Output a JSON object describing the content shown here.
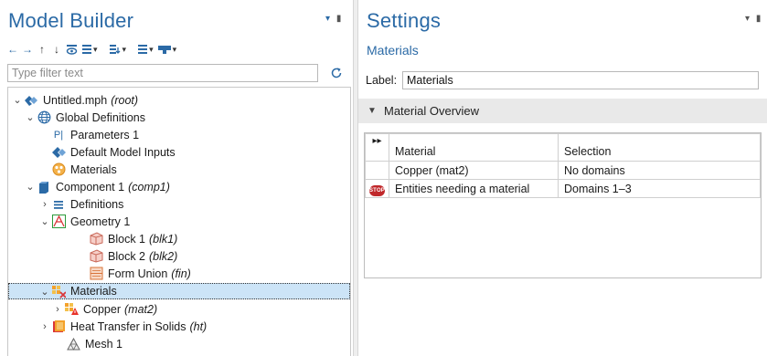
{
  "model_builder": {
    "title": "Model Builder",
    "toolbar": [
      "arrow-left-icon",
      "arrow-right-icon",
      "arrow-up-icon",
      "arrow-down-icon",
      "show-icon",
      "expand-sections-icon",
      "add-node-icon",
      "list-icon",
      "build-icon"
    ],
    "filter_placeholder": "Type filter text",
    "tree": [
      {
        "label": "Untitled.mph",
        "tag": "(root)",
        "icon": "model-file-icon",
        "expanded": true
      },
      {
        "label": "Global Definitions",
        "tag": "",
        "icon": "globe-icon",
        "expanded": true
      },
      {
        "label": "Parameters 1",
        "tag": "",
        "icon": "parameters-icon"
      },
      {
        "label": "Default Model Inputs",
        "tag": "",
        "icon": "model-inputs-icon"
      },
      {
        "label": "Materials",
        "tag": "",
        "icon": "materials-icon"
      },
      {
        "label": "Component 1",
        "tag": "(comp1)",
        "icon": "component-icon",
        "expanded": true
      },
      {
        "label": "Definitions",
        "tag": "",
        "icon": "definitions-icon",
        "expanded": false
      },
      {
        "label": "Geometry 1",
        "tag": "",
        "icon": "geometry-icon",
        "expanded": true
      },
      {
        "label": "Block 1",
        "tag": "(blk1)",
        "icon": "block-icon"
      },
      {
        "label": "Block 2",
        "tag": "(blk2)",
        "icon": "block-icon"
      },
      {
        "label": "Form Union",
        "tag": "(fin)",
        "icon": "form-union-icon"
      },
      {
        "label": "Materials",
        "tag": "",
        "icon": "materials-node-icon",
        "expanded": true,
        "selected": true
      },
      {
        "label": "Copper",
        "tag": "(mat2)",
        "icon": "material-warning-icon",
        "expanded": false
      },
      {
        "label": "Heat Transfer in Solids",
        "tag": "(ht)",
        "icon": "heat-transfer-icon",
        "expanded": false
      },
      {
        "label": "Mesh 1",
        "tag": "",
        "icon": "mesh-icon"
      }
    ]
  },
  "settings": {
    "title": "Settings",
    "subtitle": "Materials",
    "label_caption": "Label:",
    "label_value": "Materials",
    "section_title": "Material Overview",
    "table": {
      "headers": [
        "Material",
        "Selection"
      ],
      "rows": [
        {
          "status": "",
          "material": "Copper (mat2)",
          "selection": "No domains"
        },
        {
          "status": "STOP",
          "material": "Entities needing a material",
          "selection": "Domains 1–3"
        }
      ]
    }
  },
  "colors": {
    "title_blue": "#2b6aa6",
    "selection_bg": "#cce4f7",
    "stop_red": "#c0282b"
  }
}
